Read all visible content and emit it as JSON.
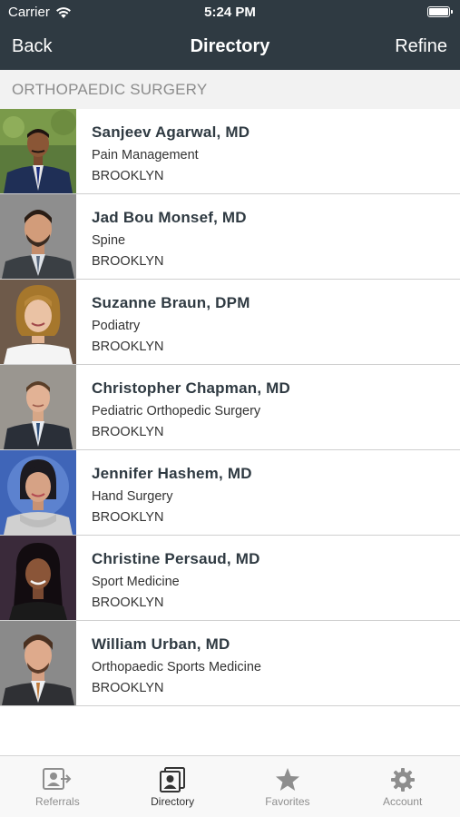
{
  "status_bar": {
    "carrier": "Carrier",
    "time": "5:24 PM"
  },
  "nav": {
    "back_label": "Back",
    "title": "Directory",
    "refine_label": "Refine"
  },
  "section": {
    "title": "ORTHOPAEDIC SURGERY"
  },
  "doctors": [
    {
      "name": "Sanjeev Agarwal, MD",
      "specialty": "Pain Management",
      "location": "BROOKLYN"
    },
    {
      "name": "Jad Bou Monsef, MD",
      "specialty": "Spine",
      "location": "BROOKLYN"
    },
    {
      "name": "Suzanne Braun, DPM",
      "specialty": "Podiatry",
      "location": "BROOKLYN"
    },
    {
      "name": "Christopher Chapman, MD",
      "specialty": "Pediatric Orthopedic Surgery",
      "location": "BROOKLYN"
    },
    {
      "name": "Jennifer Hashem, MD",
      "specialty": "Hand Surgery",
      "location": "BROOKLYN"
    },
    {
      "name": "Christine Persaud, MD",
      "specialty": "Sport Medicine",
      "location": "BROOKLYN"
    },
    {
      "name": "William Urban, MD",
      "specialty": "Orthopaedic Sports Medicine",
      "location": "BROOKLYN"
    }
  ],
  "tabs": [
    {
      "label": "Referrals",
      "icon": "referral-icon",
      "active": false
    },
    {
      "label": "Directory",
      "icon": "directory-icon",
      "active": true
    },
    {
      "label": "Favorites",
      "icon": "star-icon",
      "active": false
    },
    {
      "label": "Account",
      "icon": "gear-icon",
      "active": false
    }
  ],
  "colors": {
    "nav_background": "#2f3a42",
    "section_background": "#f2f2f2",
    "tab_active": "#333333",
    "tab_inactive": "#8e8e8e"
  }
}
